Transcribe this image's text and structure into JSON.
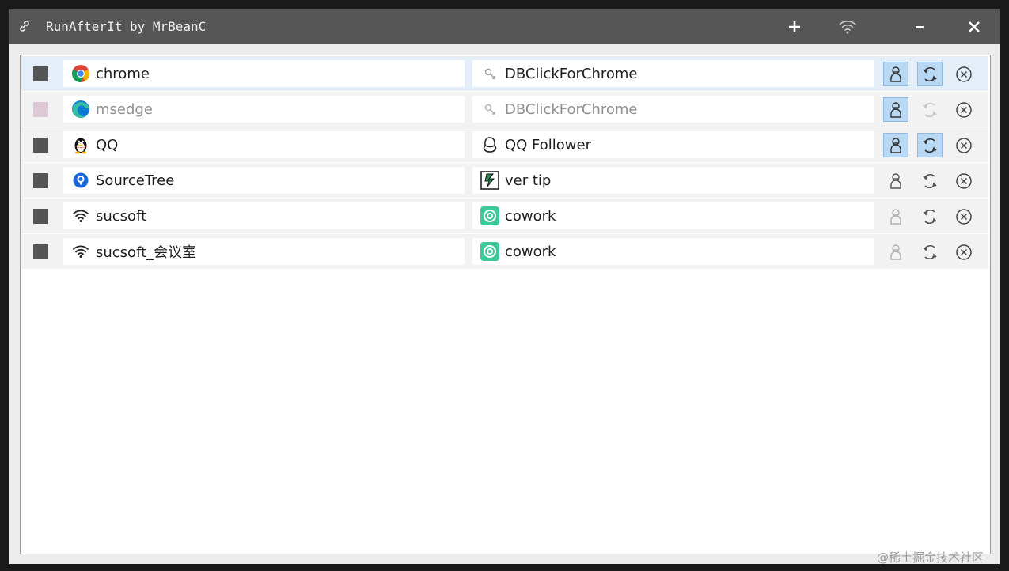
{
  "window": {
    "title": "RunAfterIt by MrBeanC"
  },
  "rows": [
    {
      "program": "chrome",
      "program_icon": "chrome-icon",
      "target": "DBClickForChrome",
      "target_icon": "script-icon",
      "enabled": true,
      "selected": true,
      "run_as_admin": true,
      "auto_restart": true
    },
    {
      "program": "msedge",
      "program_icon": "edge-icon",
      "target": "DBClickForChrome",
      "target_icon": "script-icon",
      "enabled": false,
      "selected": false,
      "run_as_admin": true,
      "auto_restart": false
    },
    {
      "program": "QQ",
      "program_icon": "qq-penguin-icon",
      "target": "QQ Follower",
      "target_icon": "qq-outline-icon",
      "enabled": true,
      "selected": false,
      "run_as_admin": true,
      "auto_restart": true
    },
    {
      "program": "SourceTree",
      "program_icon": "sourcetree-icon",
      "target": "ver tip",
      "target_icon": "ver-tip-icon",
      "enabled": true,
      "selected": false,
      "run_as_admin": false,
      "auto_restart": false
    },
    {
      "program": "sucsoft",
      "program_icon": "wifi-icon",
      "target": "cowork",
      "target_icon": "cowork-icon",
      "enabled": true,
      "selected": false,
      "run_as_admin": false,
      "auto_restart": false
    },
    {
      "program": "sucsoft_会议室",
      "program_icon": "wifi-icon",
      "target": "cowork",
      "target_icon": "cowork-icon",
      "enabled": true,
      "selected": false,
      "run_as_admin": false,
      "auto_restart": false
    }
  ],
  "watermark": "@稀土掘金技术社区",
  "colors": {
    "titlebar": "#565656",
    "toggle_on": "#b9d8f3",
    "checkbox": "#555555",
    "row_selected": "#e3eef9"
  }
}
